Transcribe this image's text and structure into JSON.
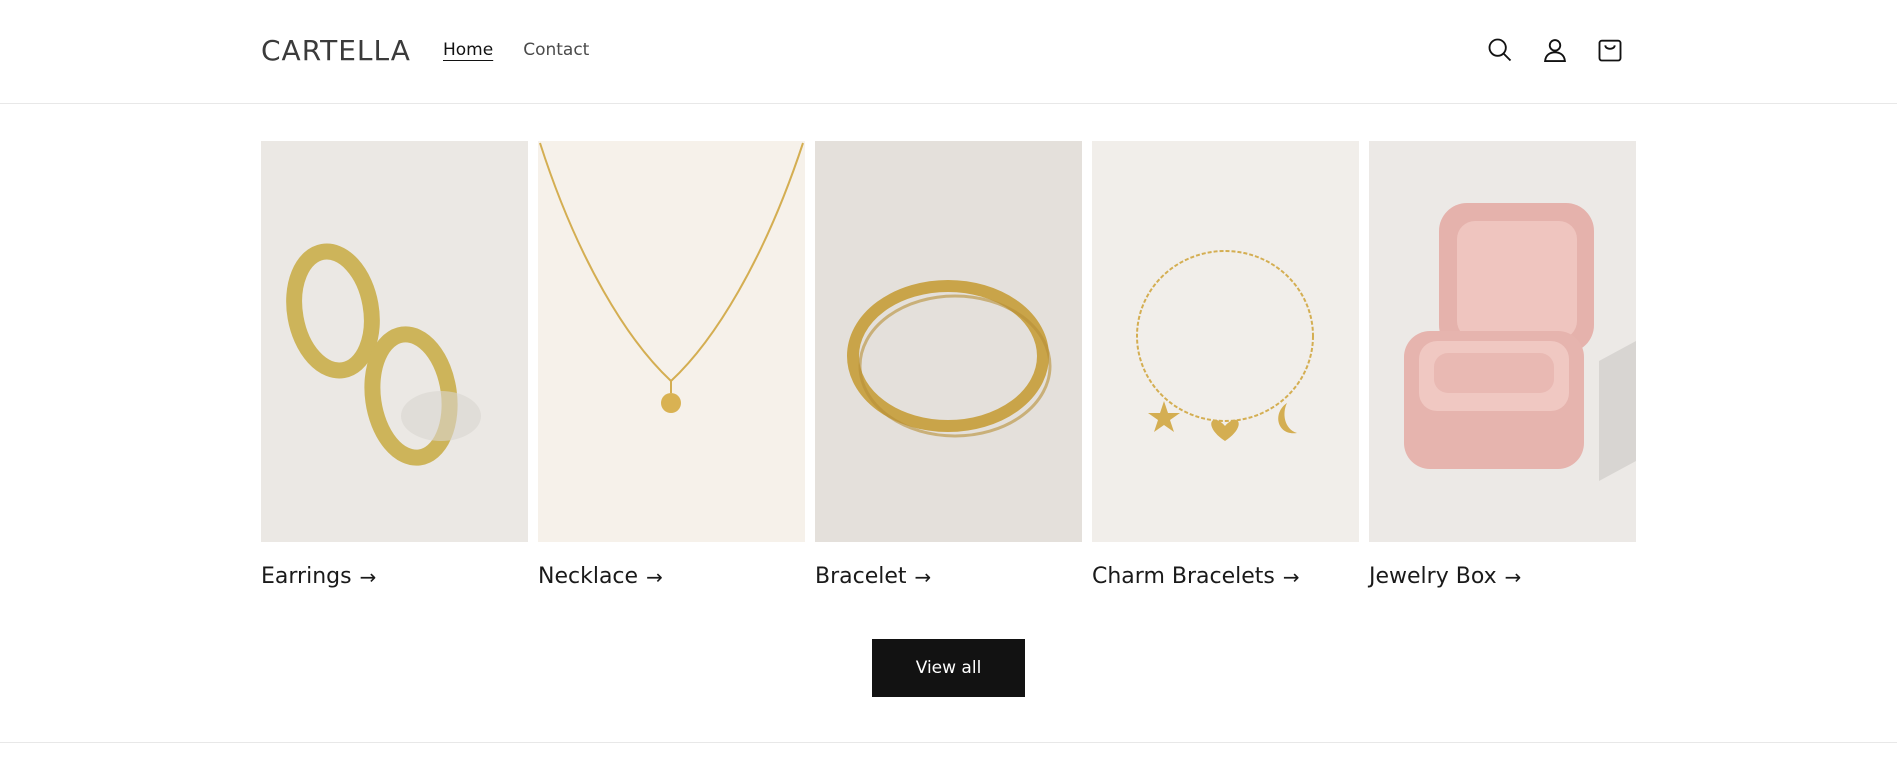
{
  "header": {
    "logo": "CARTELLA",
    "nav": [
      {
        "label": "Home",
        "active": true
      },
      {
        "label": "Contact",
        "active": false
      }
    ],
    "icons": [
      "search-icon",
      "account-icon",
      "cart-icon"
    ]
  },
  "collections": [
    {
      "title": "Earrings",
      "arrow": "→",
      "image": "gold-hoop-earrings"
    },
    {
      "title": "Necklace",
      "arrow": "→",
      "image": "gold-pendant-necklace"
    },
    {
      "title": "Bracelet",
      "arrow": "→",
      "image": "gold-bangle-bracelet"
    },
    {
      "title": "Charm Bracelets",
      "arrow": "→",
      "image": "gold-charm-bracelet"
    },
    {
      "title": "Jewelry Box",
      "arrow": "→",
      "image": "pink-velvet-ring-box"
    }
  ],
  "view_all_label": "View all",
  "colors": {
    "button_bg": "#121212",
    "gold": "#d4b04a",
    "pink_box": "#e7b6b0"
  }
}
